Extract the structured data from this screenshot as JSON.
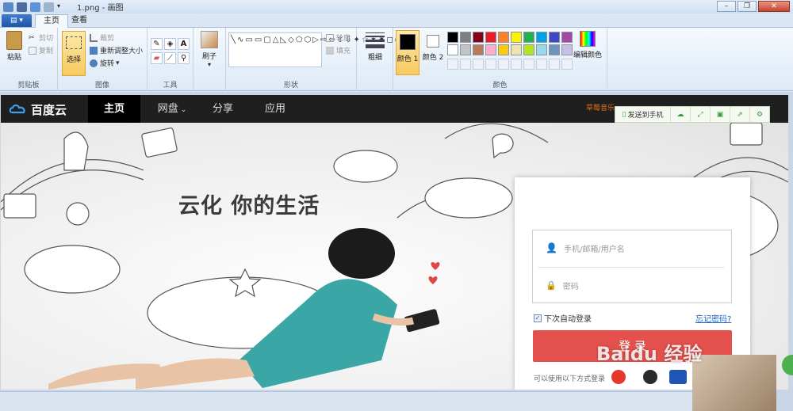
{
  "window": {
    "title": "1.png - 画图",
    "controls": [
      "minimize",
      "maximize",
      "close"
    ]
  },
  "ribbon": {
    "tabs": [
      {
        "label": "主页",
        "active": true
      },
      {
        "label": "查看",
        "active": false
      }
    ],
    "clipboard": {
      "label": "剪贴板",
      "paste": "粘贴",
      "cut": "剪切",
      "copy": "复制"
    },
    "image": {
      "label": "图像",
      "select": "选择",
      "crop": "裁剪",
      "resize": "重新调整大小",
      "rotate": "旋转"
    },
    "tools": {
      "label": "工具"
    },
    "brushes": {
      "label": "刷子"
    },
    "shapes": {
      "label": "形状",
      "outline": "轮廓",
      "fill": "填充"
    },
    "size": {
      "label": "粗细"
    },
    "colors": {
      "label": "颜色",
      "color1": "颜色 1",
      "color2": "颜色 2",
      "edit": "编辑颜色",
      "palette_row1": [
        "#000000",
        "#7f7f7f",
        "#880015",
        "#ed1c24",
        "#ff7f27",
        "#fff200",
        "#22b14c",
        "#00a2e8",
        "#3f48cc",
        "#a349a4"
      ],
      "palette_row2": [
        "#ffffff",
        "#c3c3c3",
        "#b97a57",
        "#ffaec9",
        "#ffc90e",
        "#efe4b0",
        "#b5e61d",
        "#99d9ea",
        "#7092be",
        "#c8bfe7"
      ]
    }
  },
  "baidu": {
    "logo_text": "百度云",
    "nav": [
      {
        "label": "主页",
        "active": true
      },
      {
        "label": "网盘",
        "active": false,
        "dropdown": true
      },
      {
        "label": "分享",
        "active": false
      },
      {
        "label": "应用",
        "active": false
      }
    ],
    "promo": "草莓音乐",
    "cloud_toolbar": {
      "send_to_phone": "发送到手机"
    },
    "slogan": "云化 你的生活",
    "login": {
      "username_placeholder": "手机/邮箱/用户名",
      "password_placeholder": "密码",
      "auto_login": "下次自动登录",
      "forgot": "忘记密码?",
      "login_button": "登 录",
      "other_methods": "可以使用以下方式登录"
    },
    "watermark": "Baidu 经验"
  }
}
